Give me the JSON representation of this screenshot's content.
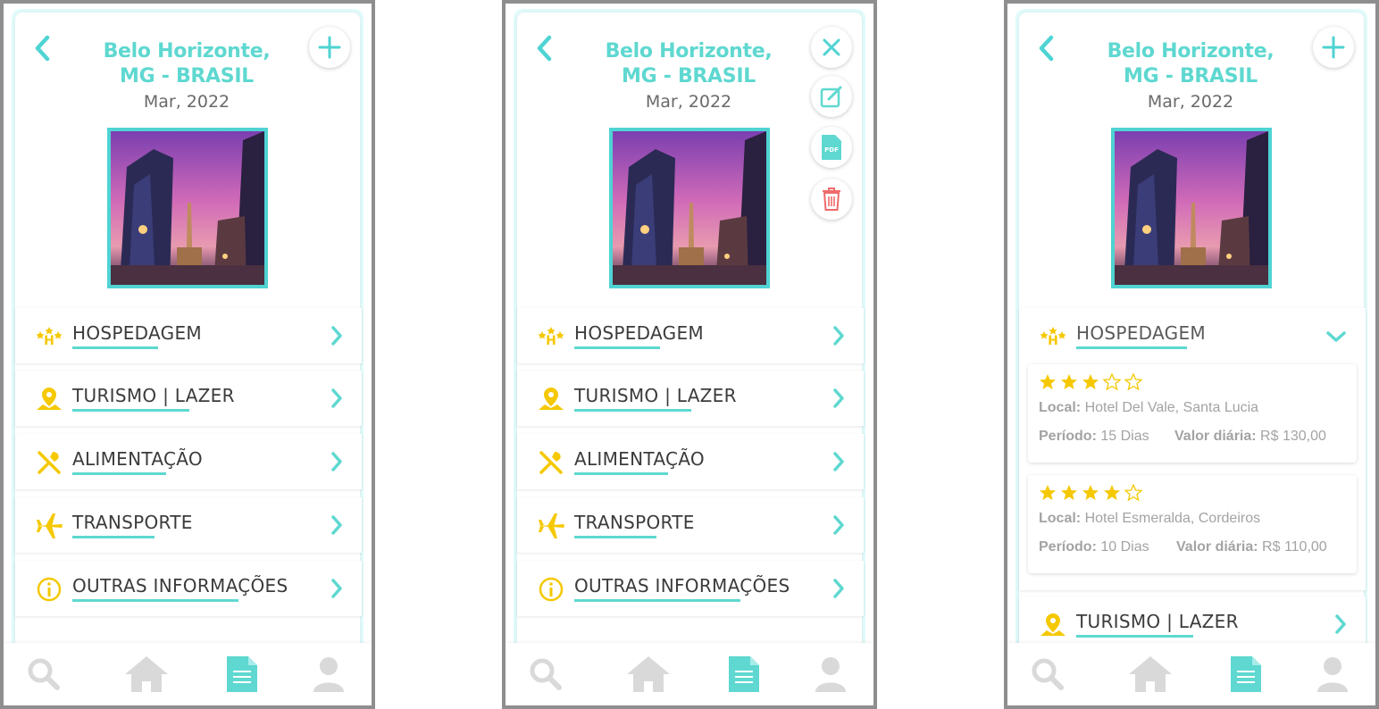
{
  "screens": [
    {
      "title_line1": "Belo Horizonte,",
      "title_line2": "MG - BRASIL",
      "date": "Mar, 2022",
      "menu_open": false,
      "categories": [
        {
          "label": "HOSPEDAGEM",
          "icon": "hotel-stars-icon"
        },
        {
          "label": "TURISMO | LAZER",
          "icon": "map-pin-icon"
        },
        {
          "label": "ALIMENTAÇÃO",
          "icon": "fork-knife-icon"
        },
        {
          "label": "TRANSPORTE",
          "icon": "airplane-icon"
        },
        {
          "label": "OUTRAS INFORMAÇÕES",
          "icon": "info-icon"
        }
      ]
    },
    {
      "title_line1": "Belo Horizonte,",
      "title_line2": "MG - BRASIL",
      "date": "Mar, 2022",
      "menu_open": true,
      "actions": [
        "close-icon",
        "edit-icon",
        "pdf-icon",
        "trash-icon"
      ],
      "categories": [
        {
          "label": "HOSPEDAGEM",
          "icon": "hotel-stars-icon"
        },
        {
          "label": "TURISMO | LAZER",
          "icon": "map-pin-icon"
        },
        {
          "label": "ALIMENTAÇÃO",
          "icon": "fork-knife-icon"
        },
        {
          "label": "TRANSPORTE",
          "icon": "airplane-icon"
        },
        {
          "label": "OUTRAS INFORMAÇÕES",
          "icon": "info-icon"
        }
      ]
    },
    {
      "title_line1": "Belo Horizonte,",
      "title_line2": "MG - BRASIL",
      "date": "Mar, 2022",
      "menu_open": false,
      "expanded_category": {
        "label": "HOSPEDAGEM",
        "icon": "hotel-stars-icon"
      },
      "hotels": [
        {
          "rating": 3,
          "local_label": "Local:",
          "local": "Hotel Del Vale, Santa Lucia",
          "periodo_label": "Período:",
          "periodo": "15 Dias",
          "valor_label": "Valor diária:",
          "valor": "R$ 130,00"
        },
        {
          "rating": 4,
          "local_label": "Local:",
          "local": "Hotel Esmeralda, Cordeiros",
          "periodo_label": "Período:",
          "periodo": "10 Dias",
          "valor_label": "Valor diária:",
          "valor": "R$ 110,00"
        }
      ],
      "next_category": {
        "label": "TURISMO | LAZER",
        "icon": "map-pin-icon"
      }
    }
  ],
  "nav": [
    "search-icon",
    "home-icon",
    "document-icon",
    "profile-icon"
  ],
  "colors": {
    "accent": "#5ed8d0",
    "icon_yellow": "#f5c800",
    "nav_gray": "#d9d9d9",
    "delete_red": "#ef6b6b",
    "star": "#f5c800"
  }
}
